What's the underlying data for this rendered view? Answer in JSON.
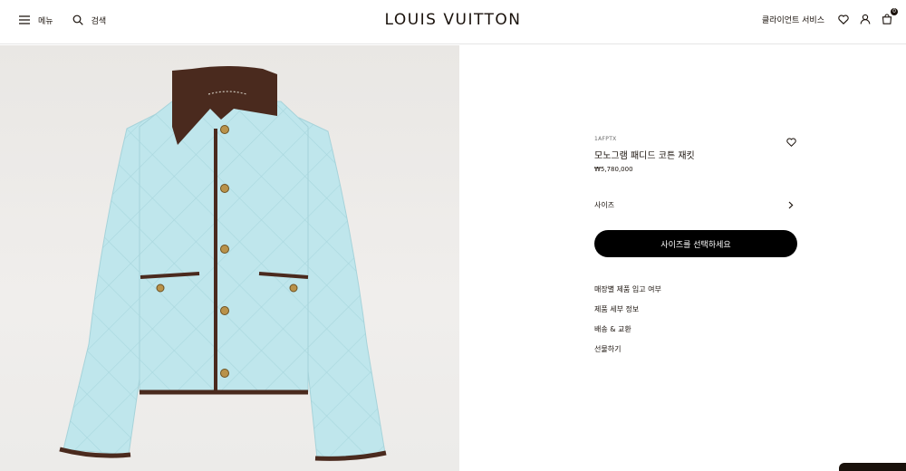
{
  "header": {
    "menu_label": "메뉴",
    "search_label": "검색",
    "logo": "LOUIS VUITTON",
    "client_service_label": "클라이언트 서비스",
    "bag_count": "0"
  },
  "product": {
    "sku": "1AFPTX",
    "name": "모노그램 패디드 코튼 재킷",
    "price": "₩5,780,000",
    "size_label": "사이즈",
    "cta_label": "사이즈를 선택하세요",
    "links": [
      "매장별 제품 입고 여부",
      "제품 세부 정보",
      "배송 & 교환",
      "선물하기"
    ]
  },
  "colors": {
    "jacket": "#bfe6ec",
    "collar": "#4a2a1e",
    "background": "#eceae7",
    "brand_text": "#19110b"
  }
}
